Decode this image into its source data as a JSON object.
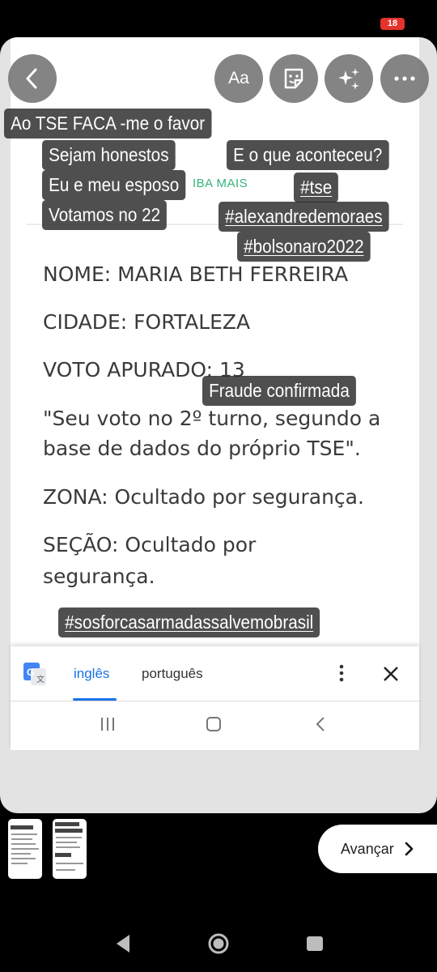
{
  "status": {
    "notification_count": "18"
  },
  "toolbar": {
    "back_icon": "chevron-left-icon",
    "text_button": "Aa",
    "sticker_icon": "sticker-icon",
    "effects_icon": "sparkles-icon",
    "more_icon": "more-horizontal-icon"
  },
  "captions": {
    "line1": "Ao TSE  FACA -me o favor",
    "line2": "Sejam honestos",
    "line3": "Eu e meu esposo",
    "line4": "Votamos no 22",
    "right1": "E o que aconteceu?",
    "hashtag_tse": "#tse",
    "hashtag_moraes": "#alexandredemoraes",
    "hashtag_bolsonaro": "#bolsonaro2022",
    "fraud": "Fraude confirmada",
    "hashtag_bottom": "#sosforcasarmadassalvemobrasil"
  },
  "document": {
    "leia_mais": "IBA MAIS",
    "nome": "NOME: MARIA BETH FERREIRA",
    "cidade": "CIDADE: FORTALEZA",
    "voto": "VOTO APURADO: 13",
    "quote_line1": "\"Seu voto no 2º turno, segundo a",
    "quote_line2": "base de dados do próprio TSE\".",
    "zona": "ZONA: Ocultado por segurança.",
    "secao_line1": "SEÇÃO: Ocultado por",
    "secao_line2": "segurança."
  },
  "translate_bar": {
    "lang_active": "inglês",
    "lang_other": "português",
    "accent_color": "#1a73e8"
  },
  "footer": {
    "advance_label": "Avançar"
  }
}
